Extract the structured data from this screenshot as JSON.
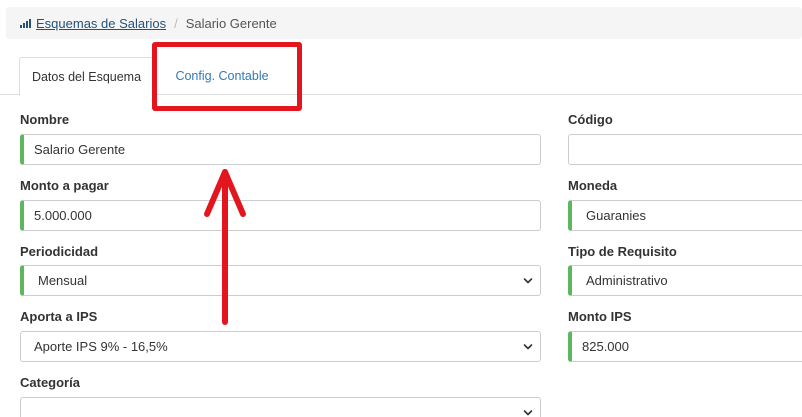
{
  "breadcrumb": {
    "parent_label": "Esquemas de Salarios",
    "separator": "/",
    "current_label": "Salario Gerente"
  },
  "tabs": [
    {
      "label": "Datos del Esquema",
      "active": true
    },
    {
      "label": "Config. Contable",
      "active": false
    }
  ],
  "form": {
    "nombre": {
      "label": "Nombre",
      "value": "Salario Gerente"
    },
    "codigo": {
      "label": "Código",
      "value": ""
    },
    "monto_pagar": {
      "label": "Monto a pagar",
      "value": "5.000.000"
    },
    "moneda": {
      "label": "Moneda",
      "value": "Guaranies"
    },
    "periodicidad": {
      "label": "Periodicidad",
      "value": "Mensual"
    },
    "tipo_requisito": {
      "label": "Tipo de Requisito",
      "value": "Administrativo"
    },
    "aporta_ips": {
      "label": "Aporta a IPS",
      "value": "Aporte IPS 9% - 16,5%"
    },
    "monto_ips": {
      "label": "Monto IPS",
      "value": "825.000"
    },
    "categoria": {
      "label": "Categoría",
      "value": ""
    }
  },
  "colors": {
    "valid_accent": "#5cb85c",
    "link": "#337ab7",
    "annotation": "#e3151f"
  },
  "icons": {
    "breadcrumb_icon": "signal-bars-icon",
    "select_caret": "chevron-down-icon"
  }
}
